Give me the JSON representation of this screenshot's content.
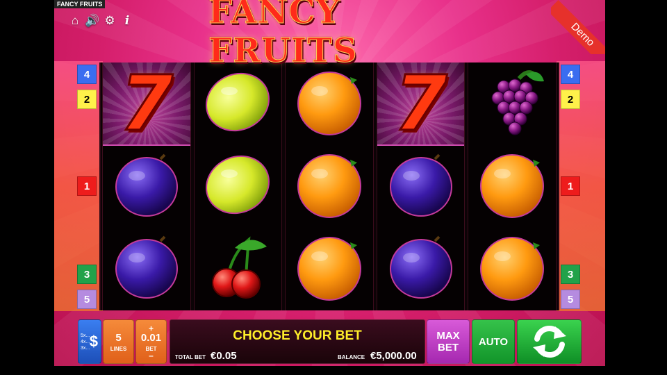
{
  "window_title": "FANCY FRUITS",
  "game": {
    "logo_text": "FANCY FRUITS",
    "demo_label": "Demo"
  },
  "top_icons": [
    "home-icon",
    "speaker-icon",
    "gear-icon",
    "info-icon"
  ],
  "reels": [
    [
      "seven",
      "plum",
      "plum"
    ],
    [
      "lemon",
      "lemon",
      "cherry"
    ],
    [
      "orange",
      "orange",
      "orange"
    ],
    [
      "seven",
      "plum",
      "plum"
    ],
    [
      "grapes",
      "orange",
      "orange"
    ]
  ],
  "paylines_left": [
    "4",
    "2",
    "1",
    "3",
    "5"
  ],
  "paylines_right": [
    "4",
    "2",
    "1",
    "3",
    "5"
  ],
  "controls": {
    "paytable_lines": [
      "5x...",
      "4x...",
      "3x..."
    ],
    "paytable_symbol": "$",
    "lines_value": "5",
    "lines_label": "LINES",
    "bet_plus": "+",
    "bet_value": "0.01",
    "bet_label": "BET",
    "bet_minus": "–",
    "message": "CHOOSE YOUR BET",
    "total_bet_label": "TOTAL BET",
    "total_bet_value": "€0.05",
    "balance_label": "BALANCE",
    "balance_value": "€5,000.00",
    "max_bet_line1": "MAX",
    "max_bet_line2": "BET",
    "auto_label": "AUTO"
  },
  "colors": {
    "payline_1": "#ee1c1c",
    "payline_2": "#fff14a",
    "payline_3": "#22a24a",
    "payline_4": "#3a6df0",
    "payline_5": "#b58be0",
    "message_yellow": "#ffee2a"
  }
}
